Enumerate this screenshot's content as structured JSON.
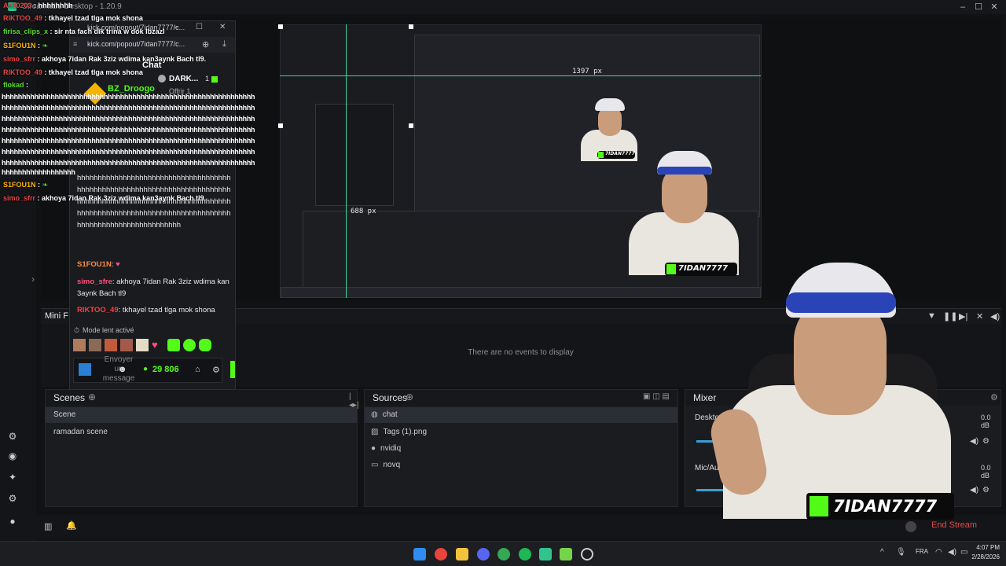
{
  "window": {
    "title": "Streamlabs Desktop - 1.20.9"
  },
  "overlay_chat": {
    "lines": [
      {
        "user": "Ac10203",
        "text": "hhhhhhhh"
      },
      {
        "user": "RIKTOO_49",
        "text": "tkhayel tzad tlga mok shona"
      },
      {
        "user": "firisa_clips_x",
        "text": "sir nta fach dik trina w dok lbzazl"
      },
      {
        "user": "S1FOU1N",
        "text": ""
      },
      {
        "user": "simo_sfrr",
        "text": "akhoya 7idan Rak 3ziz wdima kan3aynk Bach tl9."
      },
      {
        "user": "RIKTOO_49",
        "text": "tkhayel tzad tlga mok shona"
      },
      {
        "user": "flokad",
        "text": ""
      }
    ],
    "spam_text": "hhhhhhhhhhhhhhhhhhhhhhhhhhhhhhhhhhhhhhhhhhhhhhhhhhhhhhhhhhhhhh",
    "spam_last": "hhhhhhhhhhhhhhhhhh",
    "after": [
      {
        "user": "S1FOU1N",
        "text": ""
      },
      {
        "user": "simo_sfrr",
        "text": "akhoya 7idan Rak 3ziz wdima kan3aynk Bach tl9."
      }
    ]
  },
  "popout": {
    "tab_url": "kick.com/popout/7idan7777/c...",
    "url": "kick.com/popout/7idan7777/c...",
    "header": "Chat",
    "top_user": "DARK...",
    "top_count": "1",
    "pinned_user": "BZ_Droogo",
    "pinned_sub": "Offrir 1",
    "spam_block": "hhhhhhhhhhhhhhhhhhhhhhhhhhhhhhhhhhhhhhhhhhhhhhhhhhhhhhhhhhhhhhhhhhhhhhhhhhhhhhhhhhhhhhhhhhhhhhhhhhhhhhhhhhhhhhhhhhhhhhhhhhhhhhhhhhhhhhhhhhhhhhhhhhhhhhhhhhhhhhhhhhhhhhhhhhhhh",
    "messages": [
      {
        "user": "S1FOU1N",
        "text": ""
      },
      {
        "user": "simo_sfre",
        "text": "akhoya 7idan Rak 3ziz wdima kan3aynk Bach tl9"
      },
      {
        "user": "RIKTOO_49",
        "text": "tkhayel tzad tlga mok shona"
      }
    ],
    "slow_mode": "Mode lent activé",
    "input_placeholder": "Envoyer un message",
    "points": "29 806"
  },
  "preview": {
    "px_label_1": "1397 px",
    "px_label_2": "688 px"
  },
  "events": {
    "mini_label": "Mini F",
    "empty_text": "There are no events to display"
  },
  "scenes": {
    "title": "Scenes",
    "column": "Scene",
    "items": [
      "ramadan scene"
    ]
  },
  "sources": {
    "title": "Sources",
    "items": [
      {
        "label": "chat",
        "icon": "browser-icon"
      },
      {
        "label": "Tags (1).png",
        "icon": "image-icon"
      },
      {
        "label": "nvidiq",
        "icon": "webcam-icon"
      },
      {
        "label": "novq",
        "icon": "display-icon"
      }
    ]
  },
  "mixer": {
    "title": "Mixer",
    "channels": [
      {
        "name": "Desktop Audio",
        "db": "0.0 dB"
      },
      {
        "name": "Mic/Aux",
        "db": "0.0 dB"
      }
    ]
  },
  "bottom": {
    "end_stream": "End Stream"
  },
  "taskbar": {
    "lang": "FRA",
    "time": "4:07 PM",
    "date": "2/28/2026"
  },
  "brand": {
    "channel": "7IDAN7777"
  },
  "colors": {
    "kick_green": "#53fc18",
    "accent_red": "#e04c4c",
    "guide": "#3fd7a0"
  }
}
